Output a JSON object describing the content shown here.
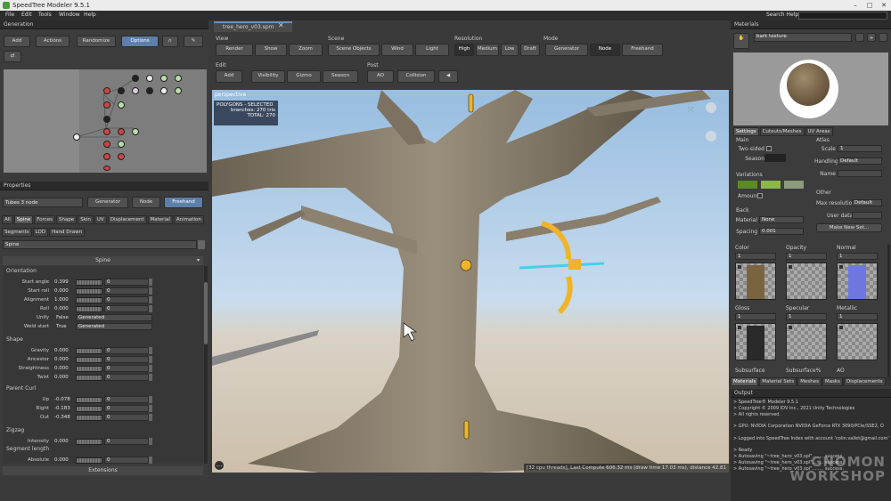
{
  "app": {
    "title": "SpeedTree  Modeler 9.5.1"
  },
  "menu": {
    "items": [
      "File",
      "Edit",
      "Tools",
      "Window",
      "Help"
    ],
    "search_label": "Search Help:"
  },
  "generation": {
    "title": "Generation",
    "buttons": [
      "Add",
      "Actions",
      "Randomize",
      "Options"
    ]
  },
  "properties": {
    "title": "Properties",
    "node_name": "Tubes 3 node",
    "mode_buttons": [
      "Generator",
      "Node",
      "Freehand"
    ],
    "tabs": [
      "All",
      "Spine",
      "Forces",
      "Shape",
      "Skin",
      "UV",
      "Displacement",
      "Material",
      "Animation"
    ],
    "tabs2": [
      "Segments",
      "LOD",
      "Hand Drawn"
    ],
    "search": "Spine",
    "section": "Spine",
    "orientation": {
      "title": "Orientation",
      "rows": [
        {
          "label": "Start angle",
          "value": "0.399",
          "spin": "0"
        },
        {
          "label": "Start roll",
          "value": "0.000",
          "spin": "0"
        },
        {
          "label": "Alignment",
          "value": "1.000",
          "spin": "0"
        },
        {
          "label": "Roll",
          "value": "0.000",
          "spin": "0"
        }
      ],
      "dropdowns": [
        {
          "label": "Unify",
          "value": "False",
          "option": "Generated"
        },
        {
          "label": "Weld start",
          "value": "True",
          "option": "Generated"
        }
      ]
    },
    "shape": {
      "title": "Shape",
      "rows": [
        {
          "label": "Gravity",
          "value": "0.000",
          "spin": "0"
        },
        {
          "label": "Ancestor",
          "value": "0.000",
          "spin": "0"
        },
        {
          "label": "Straightness",
          "value": "0.000",
          "spin": "0"
        },
        {
          "label": "Twist",
          "value": "0.000",
          "spin": "0"
        }
      ]
    },
    "parent_curl": {
      "title": "Parent Curl",
      "rows": [
        {
          "label": "Up",
          "value": "-0.078",
          "spin": "0"
        },
        {
          "label": "Right",
          "value": "-0.183",
          "spin": "0"
        },
        {
          "label": "Out",
          "value": "-0.348",
          "spin": "0"
        }
      ]
    },
    "zigzag": {
      "title": "Zigzag",
      "rows": [
        {
          "label": "Intensity",
          "value": "0.000",
          "spin": "0"
        }
      ],
      "seg_title": "Segment length",
      "seg_rows": [
        {
          "label": "Absolute",
          "value": "0.000",
          "spin": "0"
        }
      ]
    },
    "extensions": "Extensions"
  },
  "viewport": {
    "tab": "tree_hero_v03.spm",
    "groups": {
      "view": "View",
      "scene": "Scene",
      "resolution": "Resolution",
      "mode": "Mode",
      "edit": "Edit",
      "post": "Post"
    },
    "view_btns": [
      "Render",
      "Show",
      "Zoom"
    ],
    "scene_btns": [
      "Scene Objects",
      "Wind",
      "Light"
    ],
    "res_btns": [
      "High",
      "Medium",
      "Low",
      "Draft"
    ],
    "mode_btns": [
      "Generator",
      "Node",
      "Freehand"
    ],
    "edit_btns": [
      "Add",
      "Visibility",
      "Gizmo",
      "Season"
    ],
    "post_btns": [
      "AO",
      "Collision"
    ],
    "label": "perspective",
    "info": {
      "title": "POLYGONS - SELECTED",
      "l1": "branches:  270 tris",
      "l2": "TOTAL:  270"
    },
    "status": "[32 cpu threads], Last Compute 606.32 ms (draw time 17.03 ms), distance 42.81"
  },
  "materials": {
    "title": "Materials",
    "name": "bark texture",
    "tabs": [
      "Settings",
      "Cutouts/Meshes",
      "UV Areas"
    ],
    "main": {
      "title": "Main",
      "two_sided": "Two-sided",
      "season": "Season"
    },
    "variations": "Variations",
    "amount": "Amount",
    "back": {
      "title": "Back",
      "material": "Material",
      "material_val": "None",
      "spacing": "Spacing",
      "spacing_val": "0.001"
    },
    "atlas": {
      "title": "Atlas",
      "scale": "Scale",
      "scale_val": "1",
      "handling": "Handling",
      "handling_val": "Default",
      "name": "Name"
    },
    "other": {
      "title": "Other",
      "maxres": "Max resolution",
      "maxres_val": "Default",
      "userdata": "User data",
      "make": "Make New Set..."
    },
    "maps": [
      "Color",
      "Opacity",
      "Normal",
      "Gloss",
      "Specular",
      "Metallic"
    ],
    "maps2": [
      "Subsurface",
      "Subsurface%",
      "AO"
    ],
    "map_val": "1",
    "bottom_tabs": [
      "Materials",
      "Material Sets",
      "Meshes",
      "Masks",
      "Displacements"
    ]
  },
  "output": {
    "title": "Output",
    "lines": [
      "> SpeedTree® Modeler 9.5.1",
      "> Copyright © 2009 IDV Inc., 2021 Unity Technologies",
      "> All rights reserved.",
      "",
      ">  GPU: NVIDIA Corporation NVIDIA GeForce RTX 3090/PCIe/SSE2, O",
      "",
      "> Logged into SpeedTree Index with account 'colin.vallet@gmail.com'",
      "",
      "> Ready",
      "> Autosaving \"~tree_hero_v03.spl\"........ success.",
      "> Autosaving \"~tree_hero_v03.spl\"........ success.",
      "> Autosaving \"~tree_hero_v03.spl\"........ success."
    ]
  },
  "watermark": {
    "line1": "GNOMON",
    "line2": "WORKSHOP"
  },
  "colors": {
    "accent": "#5d7fa8",
    "gizmo": "#f0b429",
    "sky": "#b9d2e8"
  }
}
